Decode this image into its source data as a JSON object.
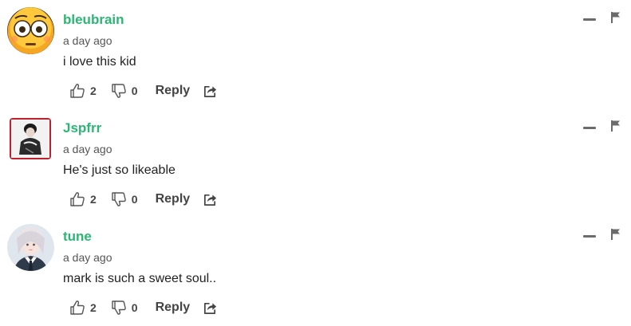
{
  "colors": {
    "username": "#2bb673",
    "meta": "#555555",
    "icon": "#555555"
  },
  "comments": [
    {
      "username": "bleubrain",
      "time": "a day ago",
      "text": "i love this kid",
      "likes": "2",
      "dislikes": "0",
      "reply_label": "Reply",
      "avatar": "flushed-face-emoji-avatar"
    },
    {
      "username": "Jspfrr",
      "time": "a day ago",
      "text": "He's just so likeable",
      "likes": "2",
      "dislikes": "0",
      "reply_label": "Reply",
      "avatar": "person-sketch-avatar"
    },
    {
      "username": "tune",
      "time": "a day ago",
      "text": "mark is such a sweet soul..",
      "likes": "2",
      "dislikes": "0",
      "reply_label": "Reply",
      "avatar": "girl-portrait-avatar"
    }
  ],
  "icons": {
    "like": "thumbs-up-icon",
    "dislike": "thumbs-down-icon",
    "share": "share-icon",
    "collapse": "minus-icon",
    "flag": "flag-icon"
  }
}
